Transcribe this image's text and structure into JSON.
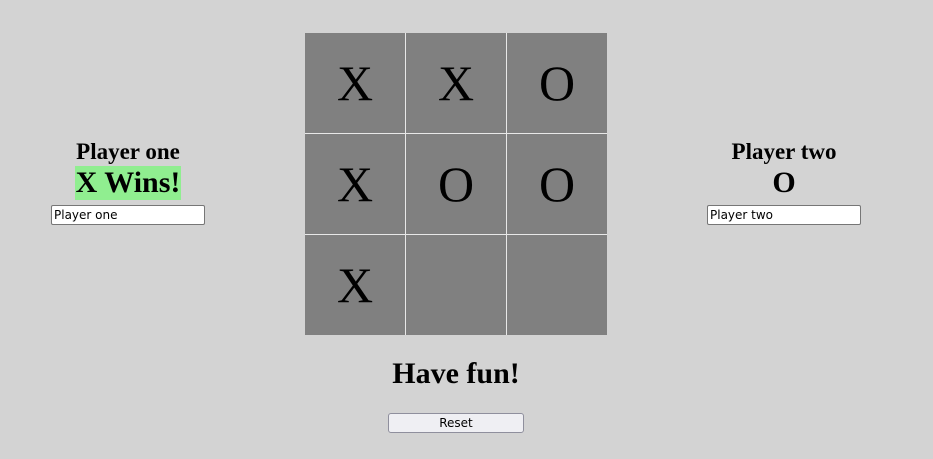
{
  "player_one": {
    "name": "Player one",
    "status": "X Wins!",
    "input_value": "Player one"
  },
  "player_two": {
    "name": "Player two",
    "status": "O",
    "input_value": "Player two"
  },
  "board": {
    "cells": [
      "X",
      "X",
      "O",
      "X",
      "O",
      "O",
      "X",
      "",
      ""
    ]
  },
  "message": "Have fun!",
  "reset_label": "Reset",
  "colors": {
    "background": "#d3d3d3",
    "cell": "#808080",
    "winner_highlight": "#90ee90"
  }
}
